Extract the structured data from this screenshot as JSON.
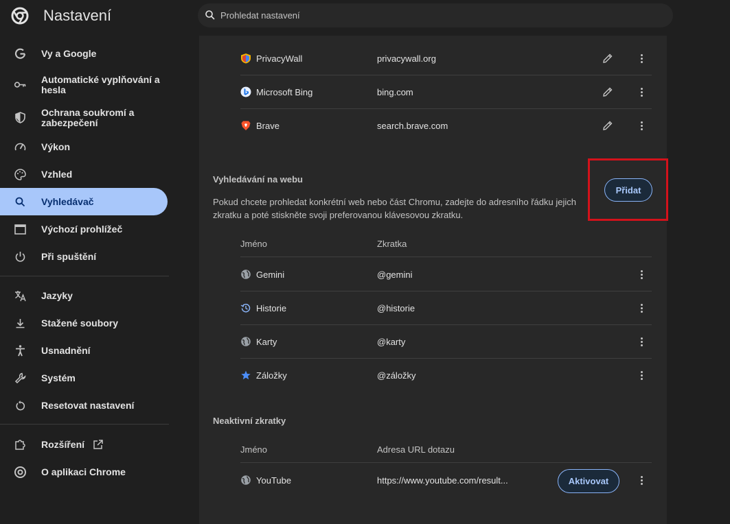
{
  "header": {
    "title": "Nastavení",
    "search_placeholder": "Prohledat nastavení"
  },
  "sidebar": {
    "items": [
      {
        "label": "Vy a Google",
        "icon": "google-icon"
      },
      {
        "label": "Automatické vyplňování a hesla",
        "icon": "key-icon"
      },
      {
        "label": "Ochrana soukromí a zabezpečení",
        "icon": "shield-icon"
      },
      {
        "label": "Výkon",
        "icon": "speedometer-icon"
      },
      {
        "label": "Vzhled",
        "icon": "palette-icon"
      },
      {
        "label": "Vyhledávač",
        "icon": "search-icon",
        "active": true
      },
      {
        "label": "Výchozí prohlížeč",
        "icon": "browser-window-icon"
      },
      {
        "label": "Při spuštění",
        "icon": "power-icon"
      },
      {
        "label": "Jazyky",
        "icon": "translate-icon"
      },
      {
        "label": "Stažené soubory",
        "icon": "download-icon"
      },
      {
        "label": "Usnadnění",
        "icon": "accessibility-icon"
      },
      {
        "label": "Systém",
        "icon": "wrench-icon"
      },
      {
        "label": "Resetovat nastavení",
        "icon": "reset-icon"
      },
      {
        "label": "Rozšíření",
        "icon": "puzzle-icon"
      },
      {
        "label": "O aplikaci Chrome",
        "icon": "chrome-icon"
      }
    ]
  },
  "engines": [
    {
      "name": "PrivacyWall",
      "keyword": "privacywall.org",
      "icon": "privacywall-icon"
    },
    {
      "name": "Microsoft Bing",
      "keyword": "bing.com",
      "icon": "bing-icon"
    },
    {
      "name": "Brave",
      "keyword": "search.brave.com",
      "icon": "brave-icon"
    }
  ],
  "site_search": {
    "title": "Vyhledávání na webu",
    "description": "Pokud chcete prohledat konkrétní web nebo část Chromu, zadejte do adresního řádku jejich zkratku a poté stiskněte svoji preferovanou klávesovou zkratku.",
    "add_label": "Přidat",
    "col_name": "Jméno",
    "col_shortcut": "Zkratka",
    "rows": [
      {
        "name": "Gemini",
        "shortcut": "@gemini",
        "icon": "globe-icon"
      },
      {
        "name": "Historie",
        "shortcut": "@historie",
        "icon": "history-icon"
      },
      {
        "name": "Karty",
        "shortcut": "@karty",
        "icon": "globe-icon"
      },
      {
        "name": "Záložky",
        "shortcut": "@záložky",
        "icon": "star-icon"
      }
    ]
  },
  "inactive": {
    "title": "Neaktivní zkratky",
    "col_name": "Jméno",
    "col_url": "Adresa URL dotazu",
    "rows": [
      {
        "name": "YouTube",
        "url": "https://www.youtube.com/result...",
        "activate_label": "Aktivovat",
        "icon": "globe-icon"
      }
    ]
  },
  "colors": {
    "accent": "#a8c7fa",
    "highlight": "#d3121b"
  }
}
